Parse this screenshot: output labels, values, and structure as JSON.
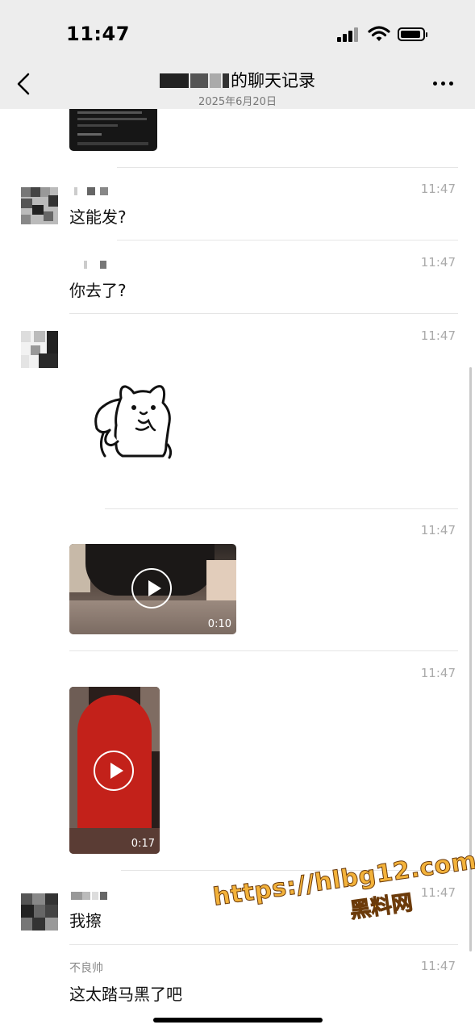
{
  "status_bar": {
    "time": "11:47"
  },
  "header": {
    "title_suffix": "的聊天记录",
    "subtitle": "2025年6月20日"
  },
  "messages": [
    {
      "time": "11:47",
      "text": "这能发?"
    },
    {
      "time": "11:47",
      "text": "你去了?"
    },
    {
      "time": "11:47"
    },
    {
      "time": "11:47",
      "duration": "0:10"
    },
    {
      "time": "11:47",
      "duration": "0:17"
    },
    {
      "time": "11:47",
      "text": "我擦"
    },
    {
      "sender": "不良帅",
      "time": "11:47",
      "text": "这太踏马黑了吧"
    }
  ],
  "watermark": {
    "url": "https://hlbg12.com",
    "name": "黑料网"
  },
  "colors": {
    "nav_bg": "#ededed",
    "separator": "#e5e5e5",
    "time_gray": "#aaaaaa",
    "watermark": "#f3b23a"
  }
}
